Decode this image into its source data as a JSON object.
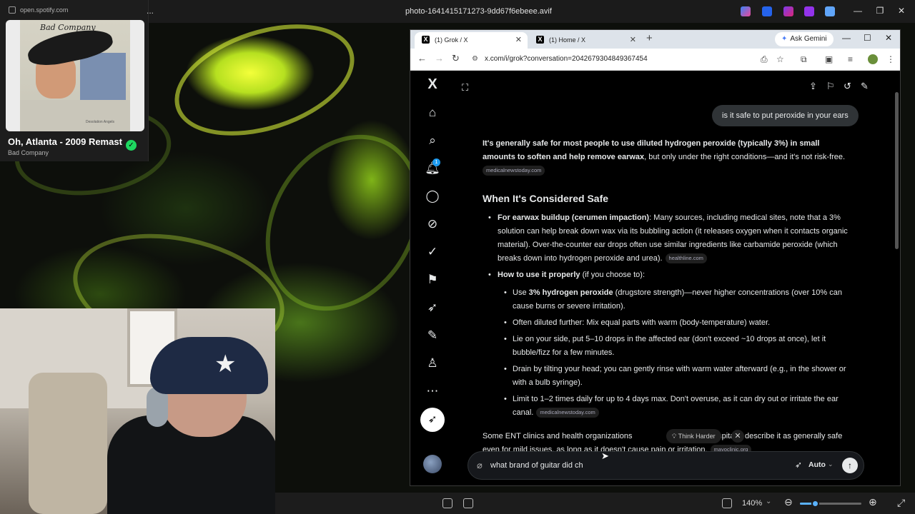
{
  "viewer": {
    "title": "photo-1641415171273-9dd67f6ebeee.avif",
    "zoom_label": "140%",
    "zoom_level_percent": 25
  },
  "spotify": {
    "url": "open.spotify.com",
    "more_label": "...",
    "album_band": "Bad Company",
    "album_caption": "Desolation Angels",
    "track_title": "Oh, Atlanta - 2009 Remaster",
    "artist": "Bad Company",
    "saved_mark": "✓"
  },
  "browser": {
    "tabs": [
      {
        "label": "(1) Grok / X",
        "active": true
      },
      {
        "label": "(1) Home / X",
        "active": false
      }
    ],
    "ask_gemini": "Ask Gemini",
    "url": "x.com/i/grok?conversation=2042679304849367454"
  },
  "x": {
    "notification_count": "1"
  },
  "chat": {
    "user_message": "is it safe to put peroxide in your ears",
    "answer": {
      "lead_bold": "It's generally safe for most people to use diluted hydrogen peroxide (typically 3%) in small amounts to soften and help remove earwax",
      "lead_rest": ", but only under the right conditions—and it's not risk-free.",
      "lead_cite": "medicalnewstoday.com",
      "heading": "When It's Considered Safe",
      "bullet1_bold": "For earwax buildup (cerumen impaction)",
      "bullet1_text": ": Many sources, including medical sites, note that a 3% solution can help break down wax via its bubbling action (it releases oxygen when it contacts organic material). Over-the-counter ear drops often use similar ingredients like carbamide peroxide (which breaks down into hydrogen peroxide and urea).",
      "bullet1_cite": "healthline.com",
      "bullet2_bold": "How to use it properly",
      "bullet2_text": " (if you choose to):",
      "sub1_pre": "Use ",
      "sub1_bold": "3% hydrogen peroxide",
      "sub1_text": " (drugstore strength)—never higher concentrations (over 10% can cause burns or severe irritation).",
      "sub2": "Often diluted further: Mix equal parts with warm (body-temperature) water.",
      "sub3": "Lie on your side, put 5–10 drops in the affected ear (don't exceed ~10 drops at once), let it bubble/fizz for a few minutes.",
      "sub4": "Drain by tilting your head; you can gently rinse with warm water afterward (e.g., in the shower or with a bulb syringe).",
      "sub5": "Limit to 1–2 times daily for up to 4 days max. Don't overuse, as it can dry out or irritate the ear canal.",
      "sub5_cite": "medicalnewstoday.com",
      "tail_a": "Some ENT clinics and health organizations",
      "tail_b": "e,",
      "tail_c": "hospitals) describe it as generally safe",
      "tail_line2": "even for mild issues, as long as it doesn't cause pain or irritation.",
      "tail_cite": "mayoclinic.org"
    },
    "think_harder": "Think Harder",
    "think_close": "✕",
    "composer_value": "what brand of guitar did ch",
    "mode_label": "Auto"
  }
}
